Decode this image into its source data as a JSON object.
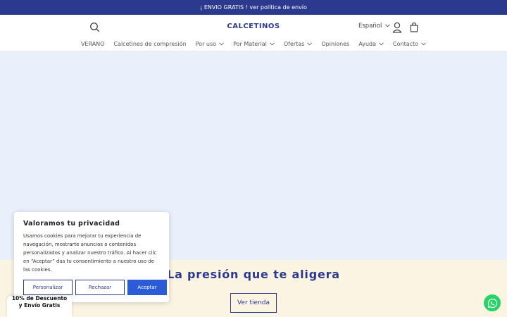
{
  "announcement": {
    "text": "¡ ENVIO GRATIS ! ver política de envío"
  },
  "header": {
    "logo_text": "CALCETINOS",
    "language": "Español"
  },
  "nav": {
    "items": [
      {
        "label": "VERANO",
        "has_dropdown": false
      },
      {
        "label": "Calcetines de compresión",
        "has_dropdown": false
      },
      {
        "label": "Por uso",
        "has_dropdown": true
      },
      {
        "label": "Por Material",
        "has_dropdown": true
      },
      {
        "label": "Ofertas",
        "has_dropdown": true
      },
      {
        "label": "Opiniones",
        "has_dropdown": false
      },
      {
        "label": "Ayuda",
        "has_dropdown": true
      },
      {
        "label": "Contacto",
        "has_dropdown": true
      }
    ]
  },
  "promo": {
    "title": "La presión que te aligera",
    "button": "Ver tienda"
  },
  "cookie_banner": {
    "title": "Valoramos tu privacidad",
    "text": "Usamos cookies para mejorar tu experiencia de navegación, mostrarte anuncios o contenidos personalizados y analizar nuestro tráfico. Al hacer clic en “Aceptar” das tu consentimiento a nuestro uso de las cookies.",
    "customize": "Personalizar",
    "reject": "Rechazar",
    "accept": "Aceptar"
  },
  "discount_tab": {
    "line1": "10% de Descuento",
    "line2": "y Envío Gratis"
  },
  "colors": {
    "brand": "#2b3a8f",
    "hero_bg": "#eaf0fb",
    "promo_bg": "#fbf4e3",
    "accept": "#2b5bd7",
    "whatsapp": "#25d366"
  }
}
